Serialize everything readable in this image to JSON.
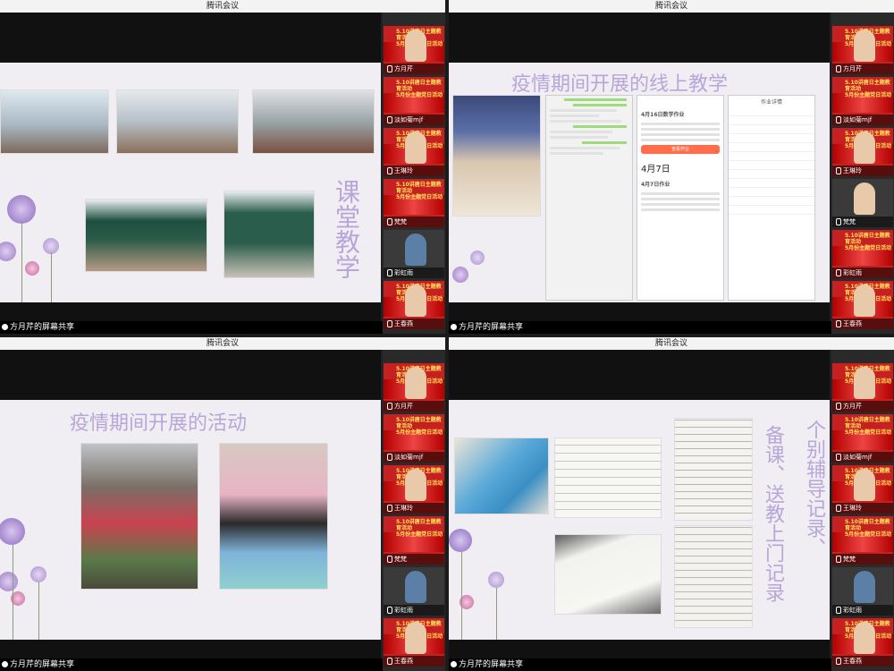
{
  "app_title": "腾讯会议",
  "share_label": "方月芹的屏幕共享",
  "participants": [
    {
      "name": "方月芹",
      "kind": "banner"
    },
    {
      "name": "淡如菊mjf",
      "kind": "banner"
    },
    {
      "name": "王琳玲",
      "kind": "banner"
    },
    {
      "name": "梵梵",
      "kind": "banner"
    },
    {
      "name": "彩虹雨",
      "kind": "dark"
    },
    {
      "name": "王春燕",
      "kind": "banner"
    }
  ],
  "banner_text_1": "5.10讲唐日主题教育活动",
  "banner_text_2": "5月份主题党日活动",
  "slides": {
    "q1": {
      "title": "课堂教学"
    },
    "q2": {
      "title": "疫情期间开展的线上教学",
      "phone2": {
        "date1": "4月7日",
        "btn_label": "查看作业",
        "head": "4月16日数学作业",
        "sub": "4月7日作业"
      },
      "phone3": {
        "head": "作业详情"
      }
    },
    "q3": {
      "title": "疫情期间开展的活动"
    },
    "q4": {
      "title_a": "个别辅导记录、",
      "title_b": "备课、送教上门记录"
    }
  },
  "colors": {
    "slide_bg": "#f0edf3",
    "title": "#b7a7d8",
    "banner_red": "#c62020"
  }
}
